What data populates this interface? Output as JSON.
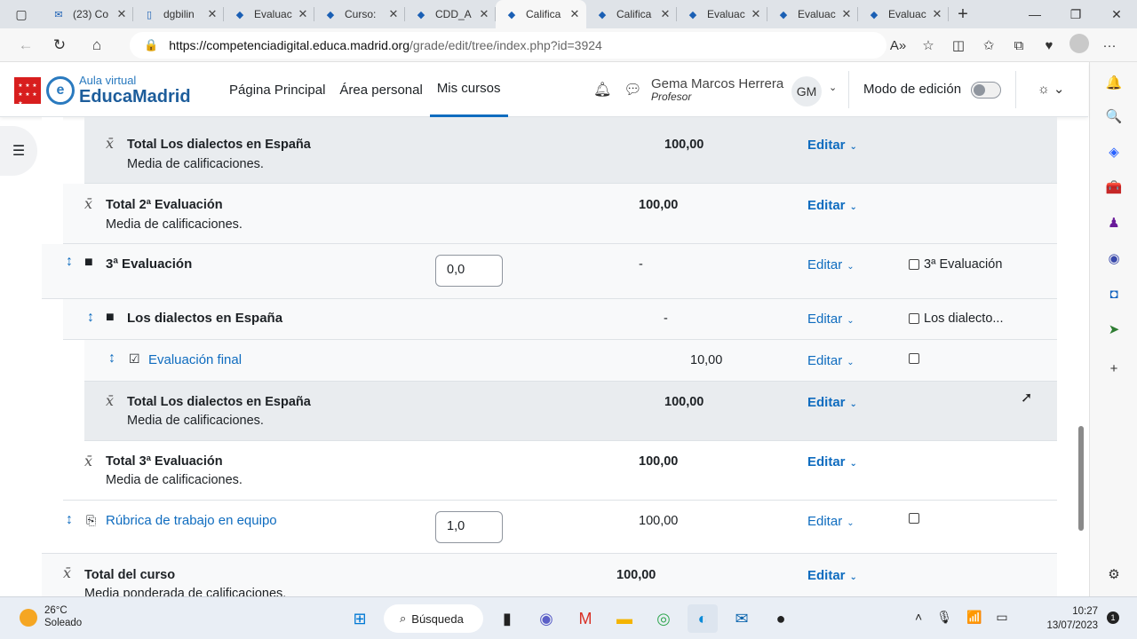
{
  "browser": {
    "tabs": [
      {
        "title": "(23) Co",
        "icon": "mail-icon"
      },
      {
        "title": "dgbilin",
        "icon": "document-icon"
      },
      {
        "title": "Evaluac",
        "icon": "moodle-cap-icon"
      },
      {
        "title": "Curso:",
        "icon": "moodle-cap-icon"
      },
      {
        "title": "CDD_A",
        "icon": "moodle-cap-icon"
      },
      {
        "title": "Califica",
        "icon": "moodle-cap-icon",
        "active": true
      },
      {
        "title": "Califica",
        "icon": "moodle-cap-icon"
      },
      {
        "title": "Evaluac",
        "icon": "moodle-cap-icon"
      },
      {
        "title": "Evaluac",
        "icon": "moodle-cap-icon"
      },
      {
        "title": "Evaluac",
        "icon": "moodle-cap-icon"
      }
    ],
    "url_domain": "https://competenciadigital.educa.madrid.org",
    "url_path": "/grade/edit/tree/index.php?id=3924"
  },
  "header": {
    "logo_small": "Aula virtual",
    "logo_big": "EducaMadrid",
    "nav": [
      "Página Principal",
      "Área personal",
      "Mis cursos"
    ],
    "user_name": "Gema Marcos Herrera",
    "user_role": "Profesor",
    "user_initials": "GM",
    "edit_mode_label": "Modo de edición"
  },
  "rows": {
    "r1": {
      "label": "Total Los dialectos en España",
      "sub": "Media de calificaciones.",
      "value": "100,00",
      "action": "Editar"
    },
    "r2": {
      "label": "Total 2ª Evaluación",
      "sub": "Media de calificaciones.",
      "value": "100,00",
      "action": "Editar"
    },
    "r3": {
      "label": "3ª Evaluación",
      "weight": "0,0",
      "value": "-",
      "action": "Editar",
      "check": "3ª Evaluación"
    },
    "r4": {
      "label": "Los dialectos en España",
      "value": "-",
      "action": "Editar",
      "check": "Los dialecto..."
    },
    "r5": {
      "label": "Evaluación final",
      "value": "10,00",
      "action": "Editar"
    },
    "r6": {
      "label": "Total Los dialectos en España",
      "sub": "Media de calificaciones.",
      "value": "100,00",
      "action": "Editar"
    },
    "r7": {
      "label": "Total 3ª Evaluación",
      "sub": "Media de calificaciones.",
      "value": "100,00",
      "action": "Editar"
    },
    "r8": {
      "label": "Rúbrica de trabajo en equipo",
      "weight": "1,0",
      "value": "100,00",
      "action": "Editar"
    },
    "r9": {
      "label": "Total del curso",
      "sub": "Media ponderada de calificaciones.",
      "value": "100,00",
      "action": "Editar"
    }
  },
  "taskbar": {
    "temp": "26°C",
    "weather": "Soleado",
    "search": "Búsqueda",
    "time": "10:27",
    "date": "13/07/2023",
    "notifications": "1"
  },
  "colors": {
    "accent": "#0f6cbf",
    "brand_red": "#d81e1e",
    "brand_blue": "#2a7abf"
  }
}
